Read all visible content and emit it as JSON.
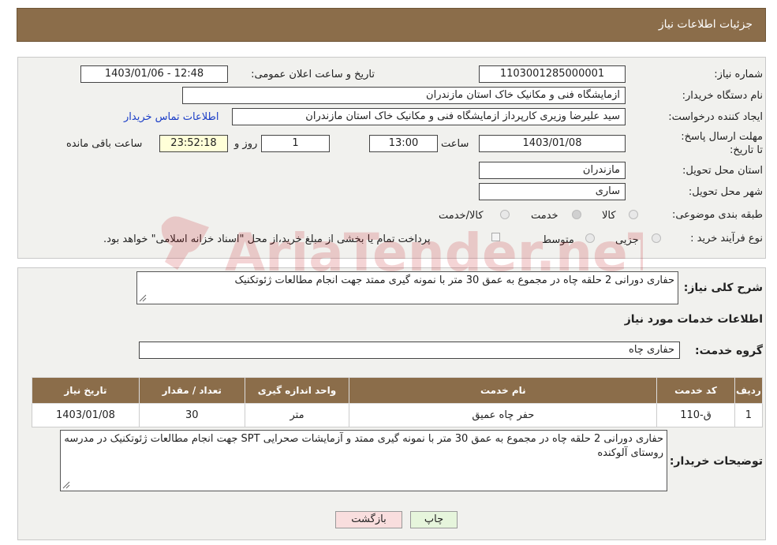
{
  "header": {
    "title": "جزئیات اطلاعات نیاز"
  },
  "form": {
    "need_number": {
      "label": "شماره نیاز:",
      "value": "1103001285000001"
    },
    "announce_datetime": {
      "label": "تاریخ و ساعت اعلان عمومی:",
      "value": "1403/01/06 - 12:48"
    },
    "buyer_org": {
      "label": "نام دستگاه خریدار:",
      "value": "ازمایشگاه فنی و مکانیک خاک استان مازندران"
    },
    "requester": {
      "label": "ایجاد کننده درخواست:",
      "value": "سید علیرضا  وزیری  کارپرداز ازمایشگاه فنی و مکانیک خاک استان مازندران",
      "contact_link": "اطلاعات تماس خریدار"
    },
    "deadline": {
      "label": "مهلت ارسال پاسخ: تا تاریخ:",
      "date": "1403/01/08",
      "time_label": "ساعت",
      "time": "13:00",
      "days": "1",
      "days_label": "روز و",
      "remaining": "23:52:18",
      "remaining_label": "ساعت باقی مانده"
    },
    "province": {
      "label": "استان محل تحویل:",
      "value": "مازندران"
    },
    "city": {
      "label": "شهر محل تحویل:",
      "value": "ساری"
    },
    "category": {
      "label": "طبقه بندی موضوعی:",
      "options": [
        "کالا",
        "خدمت",
        "کالا/خدمت"
      ],
      "selected": "خدمت"
    },
    "purchase_type": {
      "label": "نوع فرآیند خرید :",
      "options": [
        "جزیی",
        "متوسط"
      ],
      "note": "پرداخت تمام یا بخشی از مبلغ خرید،از محل \"اسناد خزانه اسلامی\" خواهد بود."
    }
  },
  "summary": {
    "label": "شرح کلی نیاز:",
    "value": "حفاری دورانی 2 حلقه چاه در مجموع به عمق 30 متر با نمونه گیری ممتد جهت انجام مطالعات ژئوتکنیک"
  },
  "services_title": "اطلاعات خدمات مورد نیاز",
  "service_group": {
    "label": "گروه خدمت:",
    "value": "حفاری چاه"
  },
  "table": {
    "headers": [
      "ردیف",
      "کد خدمت",
      "نام خدمت",
      "واحد اندازه گیری",
      "تعداد / مقدار",
      "تاریخ نیاز"
    ],
    "rows": [
      [
        "1",
        "ق-110",
        "حفر چاه عمیق",
        "متر",
        "30",
        "1403/01/08"
      ]
    ]
  },
  "buyer_notes": {
    "label": "توضیحات خریدار:",
    "value": "حفاری دورانی 2 حلقه چاه در مجموع به عمق 30 متر با نمونه گیری ممتد و آزمایشات صحرایی SPT جهت انجام مطالعات ژئوتکنیک در مدرسه روستای آلوکنده"
  },
  "buttons": {
    "print": "چاپ",
    "back": "بازگشت"
  },
  "watermark": "AriaTender.neT",
  "colors": {
    "header": "#8b6d4a",
    "print_btn": "#e6f5dc",
    "back_btn": "#f9dede",
    "link": "#1a3dc7"
  }
}
